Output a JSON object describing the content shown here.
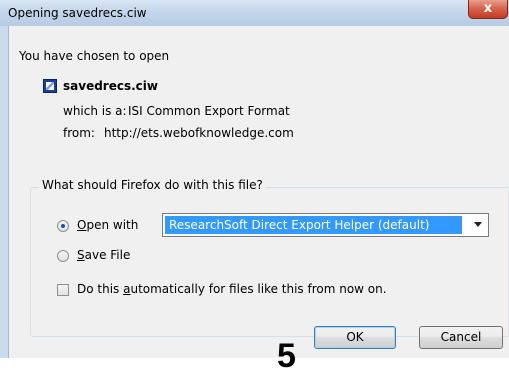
{
  "window": {
    "title": "Opening savedrecs.ciw",
    "close_label": "x"
  },
  "intro": {
    "text": "You have chosen to open",
    "filename": "savedrecs.ciw",
    "type_label": "which is a:",
    "type_value": "ISI Common Export Format",
    "from_label": "from:",
    "from_value": "http://ets.webofknowledge.com"
  },
  "action_group": {
    "legend": "What should Firefox do with this file?",
    "open_with": {
      "accel": "O",
      "label_rest": "pen with",
      "selected": true
    },
    "app_select": {
      "value": "ResearchSoft Direct Export Helper (default)"
    },
    "save_file": {
      "accel": "S",
      "label_rest": "ave File",
      "selected": false
    },
    "auto_checkbox": {
      "label_before": "Do this ",
      "accel": "a",
      "label_after": "utomatically for files like this from now on.",
      "checked": false
    }
  },
  "annotation": {
    "step": "5"
  },
  "buttons": {
    "ok": "OK",
    "cancel": "Cancel"
  }
}
